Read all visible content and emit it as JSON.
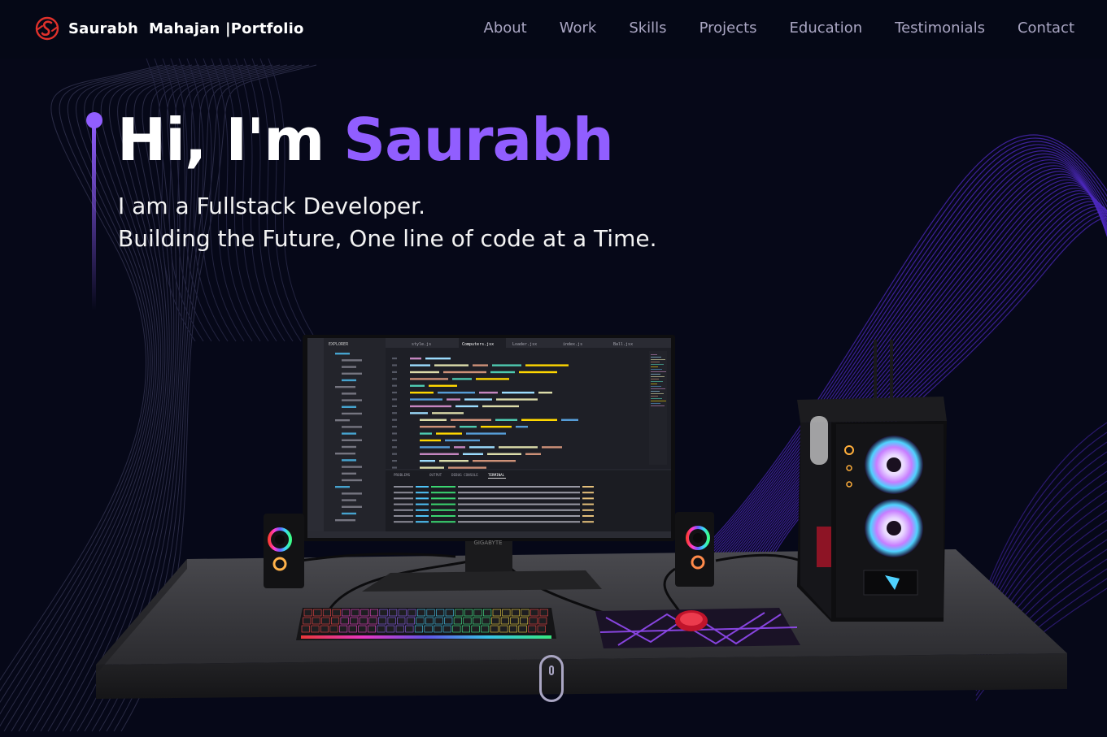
{
  "brand": {
    "name": "Saurabh  Mahajan",
    "separator": "|",
    "suffix": "Portfolio",
    "logo_icon": "s-logo-icon",
    "logo_color": "#e0312b"
  },
  "nav": {
    "items": [
      {
        "label": "About"
      },
      {
        "label": "Work"
      },
      {
        "label": "Skills"
      },
      {
        "label": "Projects"
      },
      {
        "label": "Education"
      },
      {
        "label": "Testimonials"
      },
      {
        "label": "Contact"
      }
    ]
  },
  "hero": {
    "greeting": "Hi, I'm ",
    "name": "Saurabh",
    "subtitle_line1": "I am a Fullstack Developer.",
    "subtitle_line2": "Building the Future, One line of code at a Time."
  },
  "scene": {
    "monitor_brand": "GIGABYTE",
    "editor_tabs": [
      "style.js",
      "Computers.jsx",
      "Loader.jsx",
      "index.js",
      "Ball.jsx"
    ],
    "editor_panel_tabs": [
      "PROBLEMS",
      "OUTPUT",
      "DEBUG CONSOLE",
      "TERMINAL"
    ],
    "explorer_title": "EXPLORER"
  },
  "scroll_indicator": {
    "icon": "mouse-scroll-icon"
  },
  "colors": {
    "background": "#050816",
    "accent": "#915eff",
    "nav_text": "#aaa6c3",
    "text": "#ffffff"
  }
}
